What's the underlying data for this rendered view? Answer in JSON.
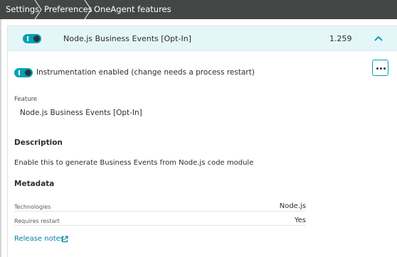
{
  "breadcrumb": {
    "items": [
      "Settings",
      "Preferences",
      "OneAgent features"
    ]
  },
  "feature_row": {
    "name": "Node.js Business Events [Opt-In]",
    "version": "1.259",
    "enabled": true
  },
  "instrumentation": {
    "label": "Instrumentation enabled (change needs a process restart)",
    "enabled": true
  },
  "details": {
    "feature_label": "Feature",
    "feature_value": "Node.js Business Events [Opt-In]",
    "description_title": "Description",
    "description_text": "Enable this to generate Business Events from Node.js code module",
    "metadata_title": "Metadata",
    "metadata": [
      {
        "key": "Technologies",
        "value": "Node.js"
      },
      {
        "key": "Requires restart",
        "value": "Yes"
      }
    ],
    "release_notes": "Release notes"
  },
  "icons": [
    "breadcrumb-separator-icon",
    "chevron-up-icon",
    "more-options-icon",
    "external-link-icon"
  ],
  "colors": {
    "breadcrumb_bg": "#454646",
    "accent": "#00a1b2",
    "row_highlight": "#e5f6f9",
    "link": "#0083a8"
  }
}
